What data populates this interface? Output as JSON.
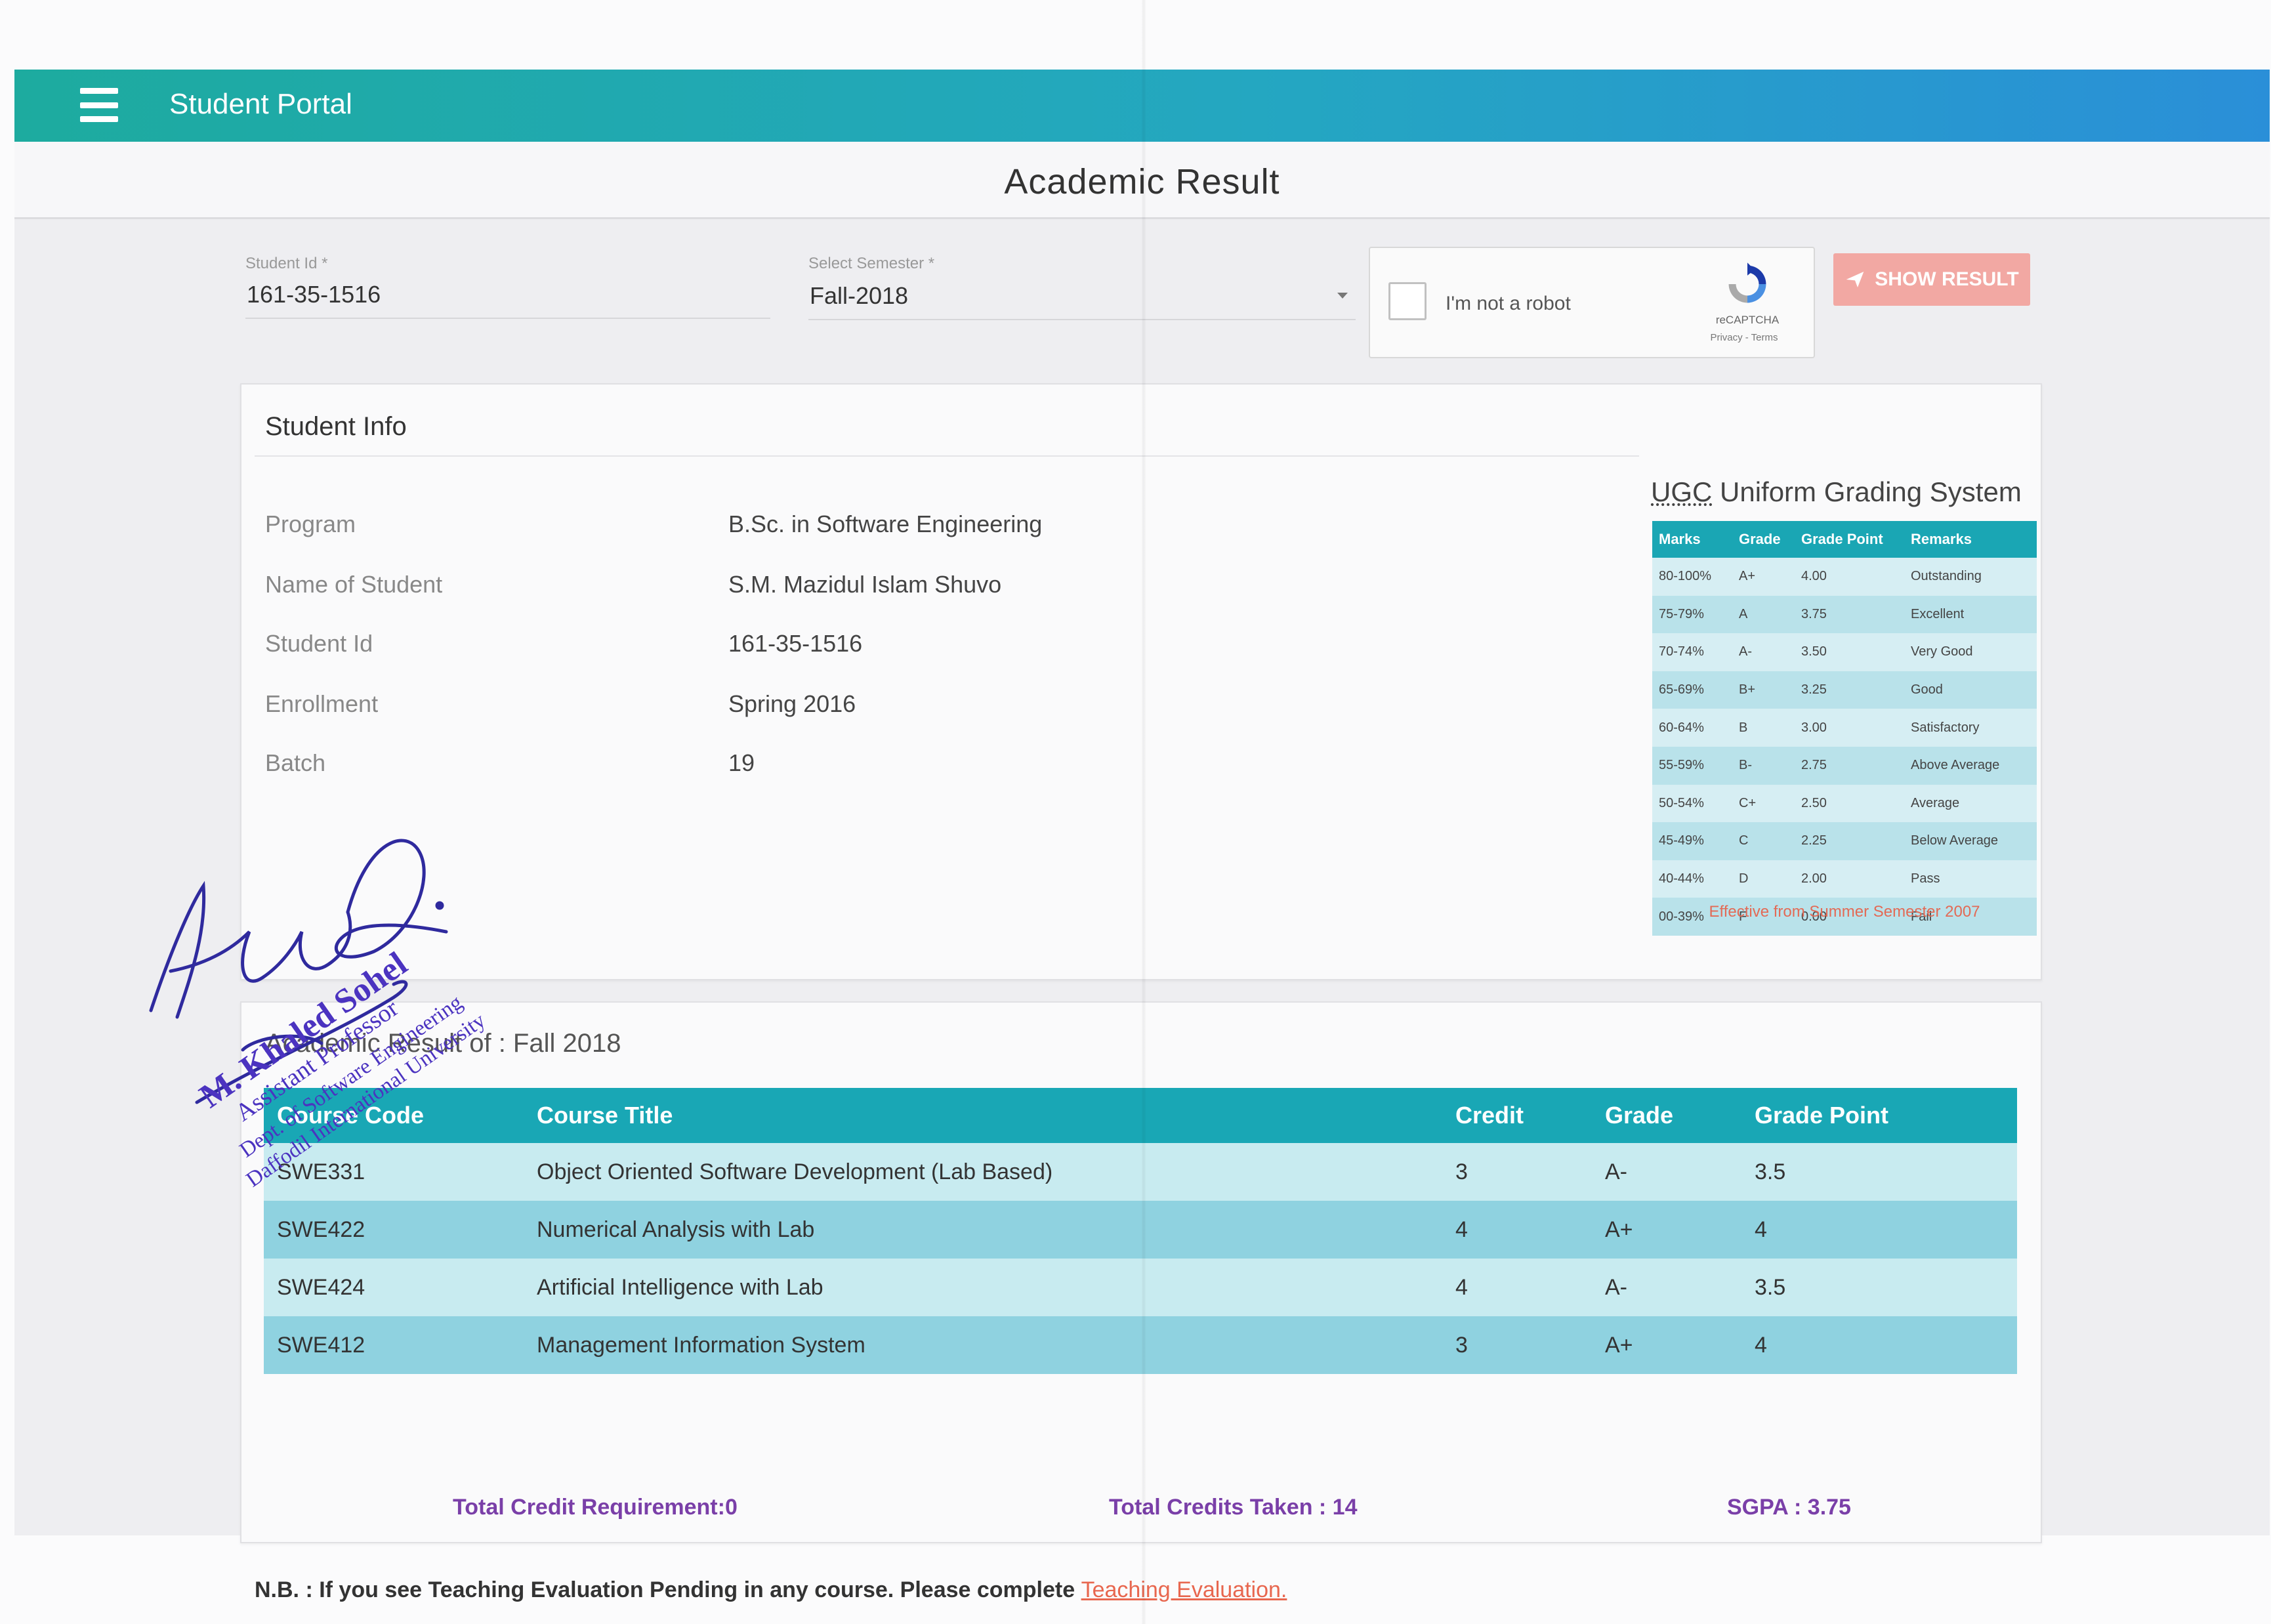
{
  "app": {
    "title": "Student Portal"
  },
  "page": {
    "title": "Academic Result"
  },
  "form": {
    "student_id_label": "Student Id *",
    "student_id_value": "161-35-1516",
    "semester_label": "Select Semester *",
    "semester_value": "Fall-2018",
    "captcha_label": "I'm not a robot",
    "captcha_brand": "reCAPTCHA",
    "captcha_links": "Privacy - Terms",
    "show_button": "SHOW RESULT"
  },
  "student_info": {
    "heading": "Student Info",
    "rows": [
      {
        "label": "Program",
        "value": "B.Sc. in Software Engineering"
      },
      {
        "label": "Name of Student",
        "value": "S.M. Mazidul Islam Shuvo"
      },
      {
        "label": "Student Id",
        "value": "161-35-1516"
      },
      {
        "label": "Enrollment",
        "value": "Spring 2016"
      },
      {
        "label": "Batch",
        "value": "19"
      }
    ]
  },
  "ugc": {
    "title_abbr": "UGC",
    "title_rest": " Uniform Grading System",
    "headers": [
      "Marks",
      "Grade",
      "Grade Point",
      "Remarks"
    ],
    "rows": [
      [
        "80-100%",
        "A+",
        "4.00",
        "Outstanding"
      ],
      [
        "75-79%",
        "A",
        "3.75",
        "Excellent"
      ],
      [
        "70-74%",
        "A-",
        "3.50",
        "Very Good"
      ],
      [
        "65-69%",
        "B+",
        "3.25",
        "Good"
      ],
      [
        "60-64%",
        "B",
        "3.00",
        "Satisfactory"
      ],
      [
        "55-59%",
        "B-",
        "2.75",
        "Above Average"
      ],
      [
        "50-54%",
        "C+",
        "2.50",
        "Average"
      ],
      [
        "45-49%",
        "C",
        "2.25",
        "Below Average"
      ],
      [
        "40-44%",
        "D",
        "2.00",
        "Pass"
      ],
      [
        "00-39%",
        "F",
        "0.00",
        "Fail"
      ]
    ],
    "note": "Effective from Summer Semester 2007"
  },
  "result": {
    "heading": "Academic Result of : Fall 2018",
    "headers": [
      "Course Code",
      "Course Title",
      "Credit",
      "Grade",
      "Grade Point"
    ],
    "rows": [
      [
        "SWE331",
        "Object Oriented Software Development (Lab Based)",
        "3",
        "A-",
        "3.5"
      ],
      [
        "SWE422",
        "Numerical Analysis with Lab",
        "4",
        "A+",
        "4"
      ],
      [
        "SWE424",
        "Artificial Intelligence with Lab",
        "4",
        "A-",
        "3.5"
      ],
      [
        "SWE412",
        "Management Information System",
        "3",
        "A+",
        "4"
      ]
    ],
    "total_requirement": "Total Credit Requirement:0",
    "total_taken": "Total Credits Taken : 14",
    "sgpa": "SGPA : 3.75"
  },
  "note": {
    "text": "N.B. : If you see Teaching Evaluation Pending in any course. Please complete ",
    "link": "Teaching Evaluation."
  },
  "stamp": {
    "name": "M. Khaled Sohel",
    "title": "Assistant Professor",
    "dept": "Dept. of Software Engineering",
    "university": "Daffodil International University"
  },
  "colors": {
    "appbar_start": "#1dab9f",
    "appbar_end": "#2a8fd8",
    "table_header": "#19a7b5",
    "accent_red": "#e8674f",
    "totals_purple": "#7a3fa8",
    "stamp_blue": "#3b2fb8"
  }
}
